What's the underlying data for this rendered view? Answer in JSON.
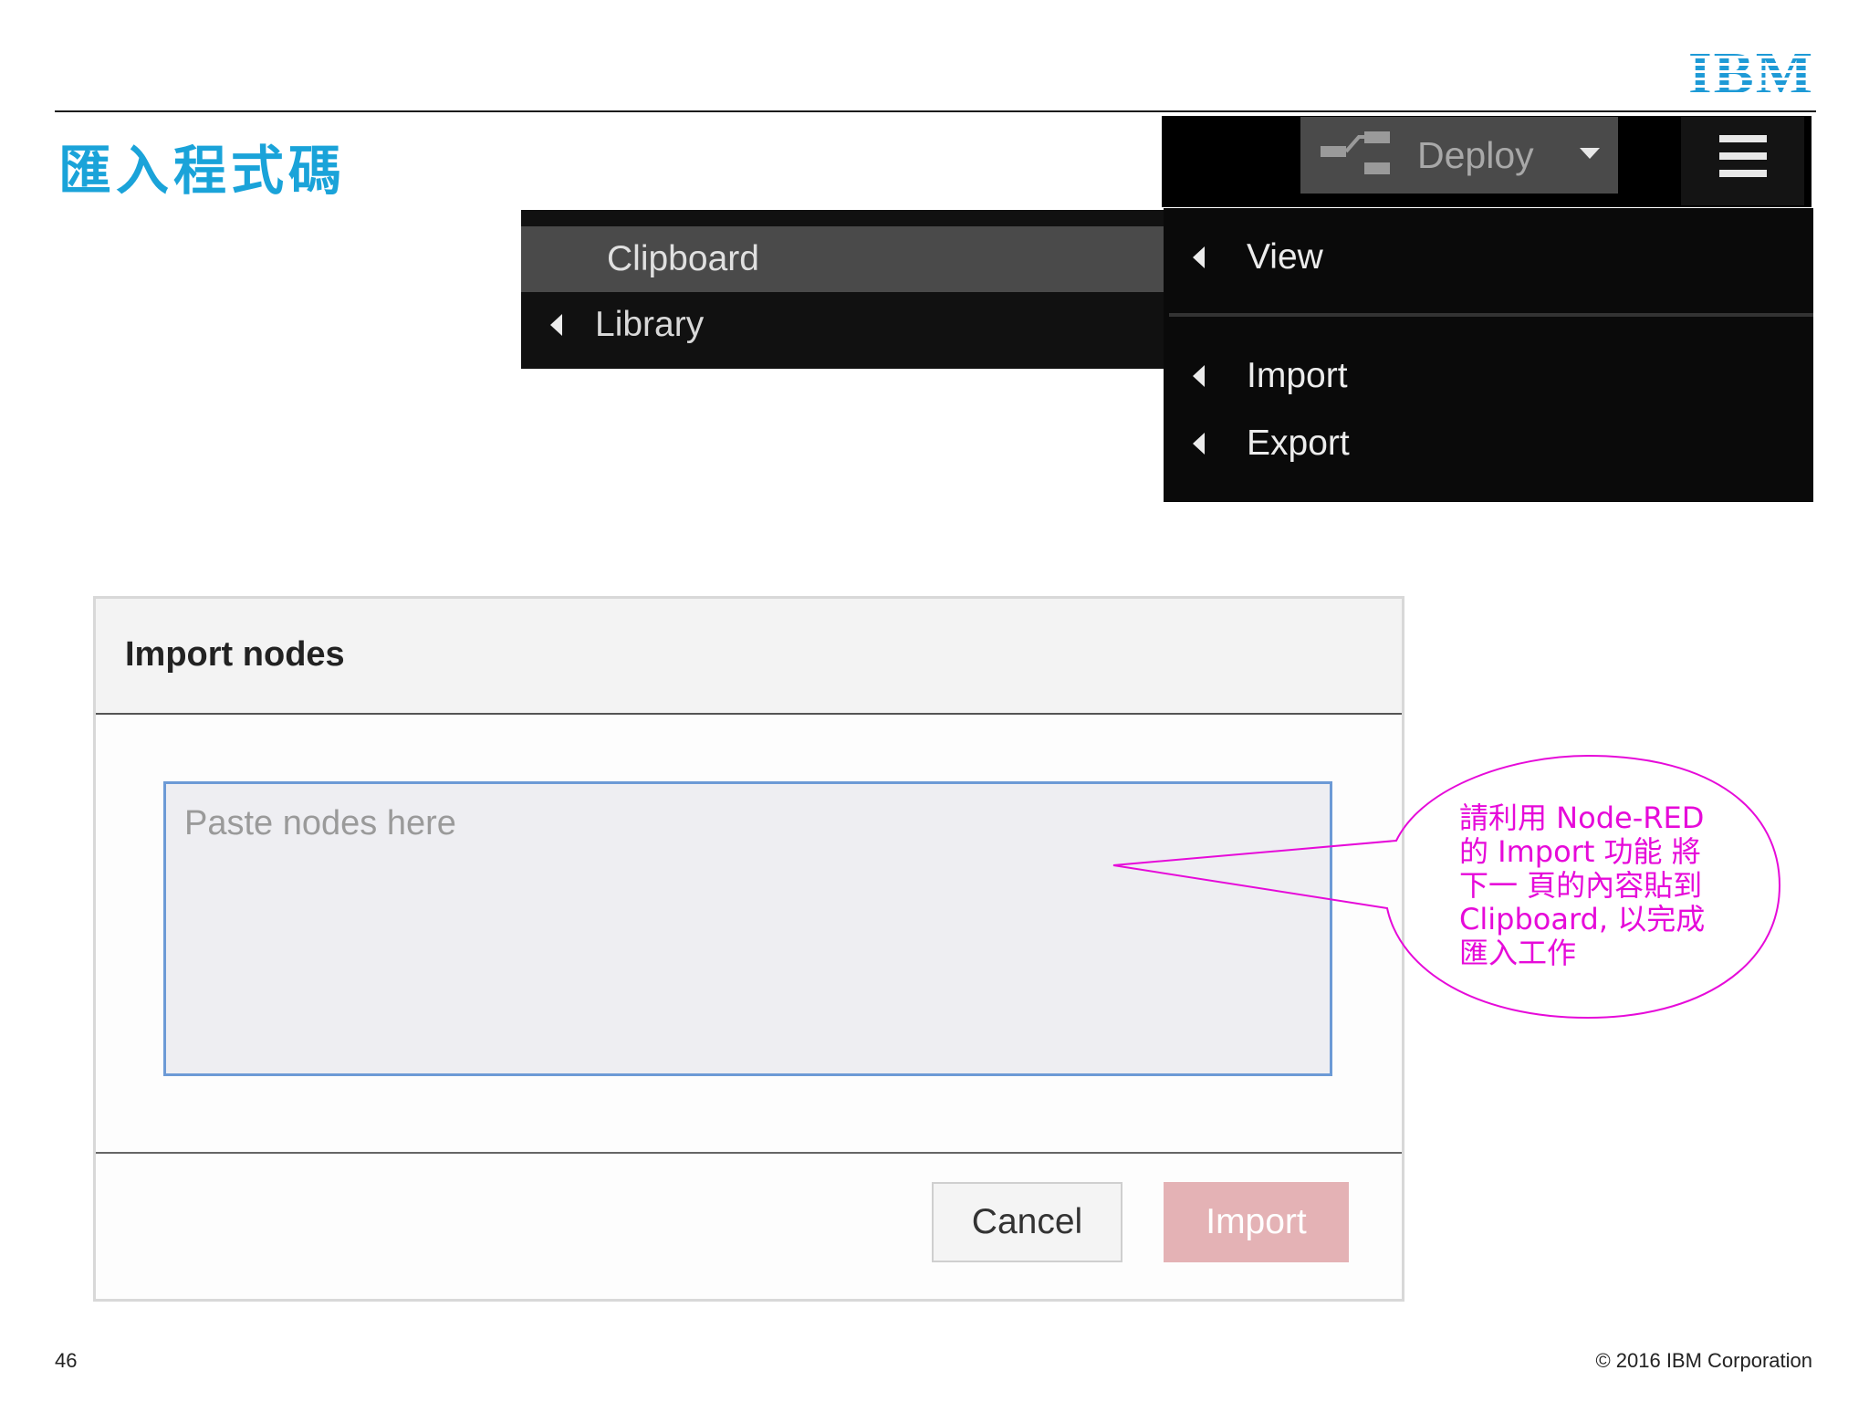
{
  "slide": {
    "title": "匯入程式碼",
    "logo_text": "IBM",
    "page_number": "46",
    "copyright": "© 2016 IBM Corporation"
  },
  "toolbar": {
    "deploy_label": "Deploy"
  },
  "menu_left": {
    "items": [
      {
        "label": "Clipboard"
      },
      {
        "label": "Library"
      }
    ]
  },
  "menu_right": {
    "items": [
      {
        "label": "View"
      },
      {
        "label": "Import"
      },
      {
        "label": "Export"
      }
    ]
  },
  "dialog": {
    "title": "Import nodes",
    "textarea_placeholder": "Paste nodes here",
    "textarea_value": "",
    "cancel_label": "Cancel",
    "import_label": "Import"
  },
  "annotation": {
    "text": "請利用 Node-RED 的 Import 功能 將下一 頁的內容貼到 Clipboard, 以完成匯入工作"
  },
  "colors": {
    "title_blue": "#1aa3d9",
    "annotation_magenta": "#e60ad9",
    "import_button_disabled": "#e4b2b5",
    "menu_background": "#111111",
    "menu_highlight": "#4a4a4a"
  },
  "icons": {
    "deploy": "deploy-flow-icon",
    "deploy_dropdown": "caret-down-icon",
    "menu": "hamburger-menu-icon",
    "submenu": "caret-left-icon"
  }
}
